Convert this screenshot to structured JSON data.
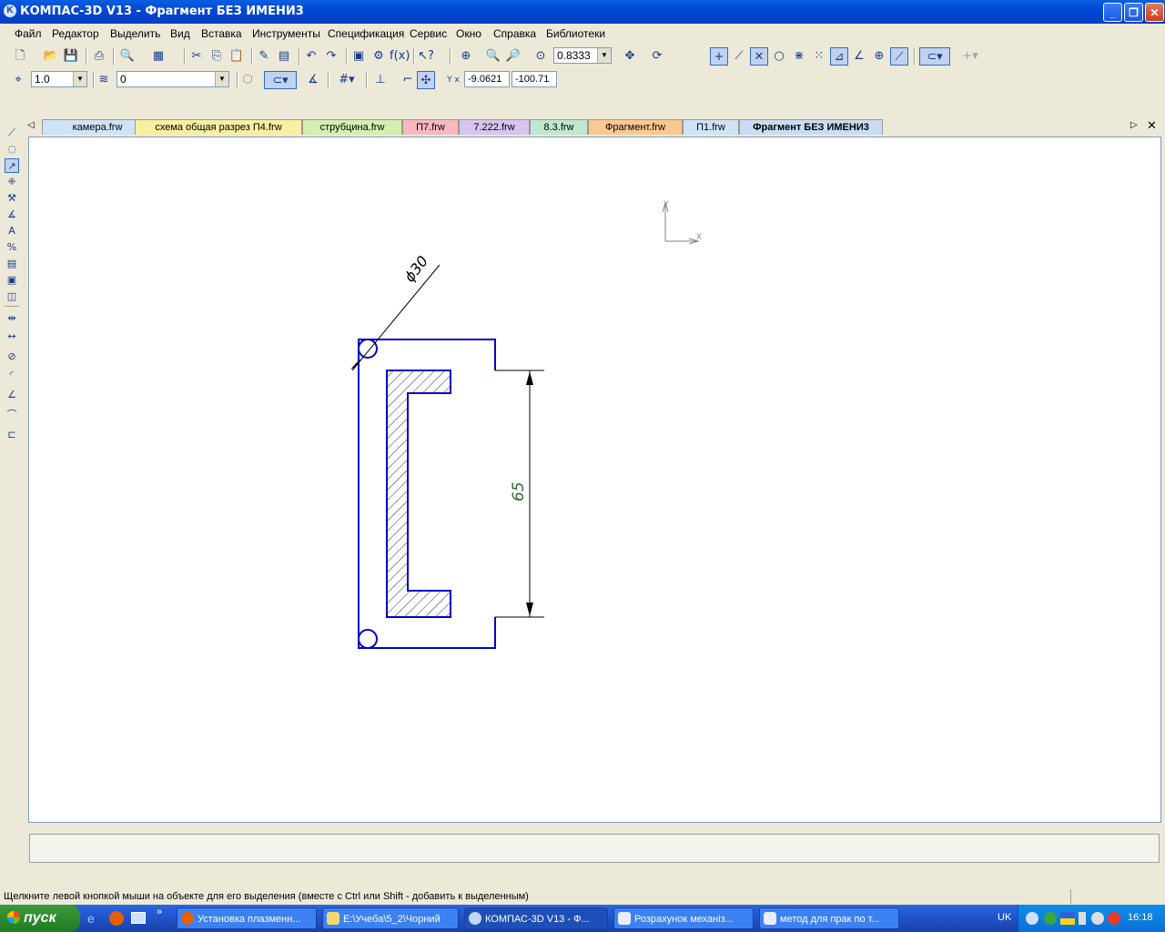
{
  "window": {
    "title": "КОМПАС-3D V13 - Фрагмент БЕЗ ИМЕНИ3",
    "app_icon": "kompas-icon"
  },
  "menu": [
    "Файл",
    "Редактор",
    "Выделить",
    "Вид",
    "Вставка",
    "Инструменты",
    "Спецификация",
    "Сервис",
    "Окно",
    "Справка",
    "Библиотеки"
  ],
  "toolbar": {
    "zoom_value": "0.8333"
  },
  "props": {
    "step_value": "1.0",
    "layer_value": "0",
    "coord_x": "-9.0621",
    "coord_y": "-100.71"
  },
  "tabs": [
    {
      "label": "камера.frw",
      "color": "#CFE3F7"
    },
    {
      "label": "схема общая разрез П4.frw",
      "color": "#F8F0A0"
    },
    {
      "label": "струбцина.frw",
      "color": "#D6EEB0"
    },
    {
      "label": "П7.frw",
      "color": "#F7B8C0"
    },
    {
      "label": "7.222.frw",
      "color": "#D8C4F0"
    },
    {
      "label": "8.3.frw",
      "color": "#BFE8D0"
    },
    {
      "label": "Фрагмент.frw",
      "color": "#FAC890"
    },
    {
      "label": "П1.frw",
      "color": "#CFE3F7"
    },
    {
      "label": "Фрагмент БЕЗ ИМЕНИ3",
      "color": "#C8DDF4"
    }
  ],
  "drawing": {
    "dim_diameter": "ϕ30",
    "dim_length": "65",
    "axis_y": "Y",
    "axis_x": "X",
    "line_color": "#0000C8"
  },
  "status": {
    "hint": "Щелкните левой кнопкой мыши на объекте для его выделения (вместе с Ctrl или Shift - добавить к выделенным)"
  },
  "taskbar": {
    "start": "пуск",
    "tasks": [
      {
        "label": "Установка плазменн..."
      },
      {
        "label": "E:\\Учеба\\5_2\\Чорний"
      },
      {
        "label": "КОМПАС-3D V13 - Ф..."
      },
      {
        "label": "Розрахунок механіз..."
      },
      {
        "label": "метод для прак по т..."
      }
    ],
    "lang": "UK",
    "clock": "16:18"
  }
}
